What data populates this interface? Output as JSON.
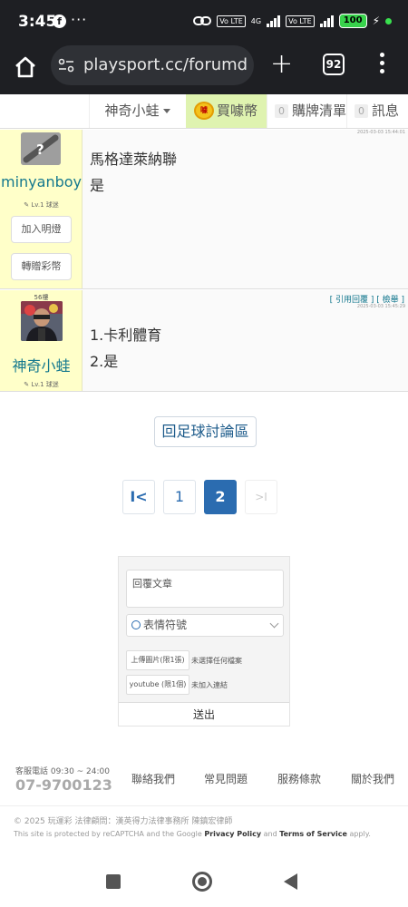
{
  "status_bar": {
    "time": "3:45",
    "app_icon": "facebook-icon",
    "more": "···",
    "volte1": "Vo LTE",
    "net": "4G",
    "volte2": "Vo LTE",
    "battery": "100"
  },
  "browser": {
    "url": "playsport.cc/forumde",
    "tab_count": "92"
  },
  "site_bar": {
    "user_menu": "神奇小蛙",
    "buy_coin": "買噱幣",
    "coin_icon_text": "噱",
    "cart_count": "0",
    "cart_label": "購牌清單",
    "msg_count": "0",
    "msg_label": "訊息"
  },
  "posts": [
    {
      "username": "minyanboy",
      "level": "✎ Lv.1 球迷",
      "timestamp": "2025-03-03 15:44:01",
      "lines": [
        "馬格達萊納聯",
        "是"
      ],
      "add_friend": "加入明燈",
      "transfer_coin": "轉贈彩幣"
    },
    {
      "floor": "56樓",
      "username": "神奇小蛙",
      "level": "✎ Lv.1 球迷",
      "quote": "[ 引用回覆 ]",
      "report": "[ 檢舉 ]",
      "timestamp": "2025-03-03 15:45:29",
      "lines": [
        "1.卡利體育",
        "2.是"
      ]
    }
  ],
  "back_button": "回足球討論區",
  "pagination": {
    "first": "I<",
    "pages": [
      "1",
      "2"
    ],
    "current": "2",
    "last": ">I"
  },
  "reply_form": {
    "textarea_placeholder": "回覆文章",
    "emoji_label": "表情符號",
    "upload_image": "上傳圖片(限1張)",
    "upload_note": "未選擇任何檔案",
    "youtube": "youtube (限1個)",
    "youtube_note": "未加入連結",
    "send": "送出"
  },
  "footer": {
    "hotline_label": "客服電話 09:30 ~ 24:00",
    "hotline": "07-9700123",
    "links": [
      "聯絡我們",
      "常見問題",
      "服務條款",
      "關於我們"
    ],
    "copyright": "© 2025 玩運彩 法律顧問：漢英得力法律事務所 陳鎮宏律師",
    "captcha_pre": "This site is protected by reCAPTCHA and the Google ",
    "privacy": "Privacy Policy",
    "and": " and ",
    "terms": "Terms of Service",
    "apply": " apply."
  },
  "colors": {
    "accent": "#2b6cb0",
    "username": "#14788e",
    "side_bg": "#ffffc9",
    "coin_bg": "#dff3b0"
  }
}
